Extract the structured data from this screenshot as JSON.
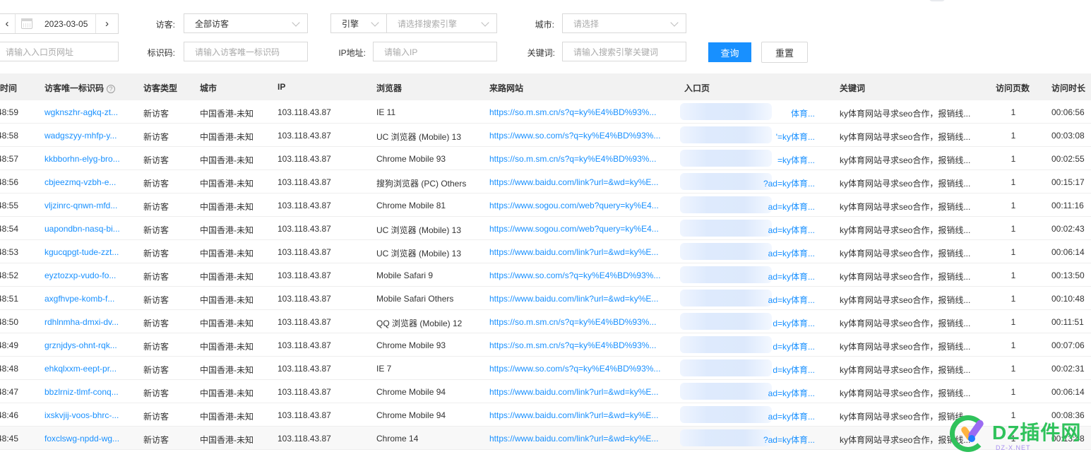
{
  "filters": {
    "date": {
      "value": "2023-03-05",
      "prev_icon": "chevron-left-icon",
      "next_icon": "chevron-right-icon",
      "calendar_icon": "calendar-icon"
    },
    "visitor": {
      "label": "访客:",
      "value": "全部访客"
    },
    "engine": {
      "type_value": "引擎",
      "placeholder": "请选择搜索引擎"
    },
    "city": {
      "label": "城市:",
      "placeholder": "请选择"
    },
    "entry_url": {
      "placeholder": "请输入入口页网址"
    },
    "visitor_id": {
      "label": "标识码:",
      "placeholder": "请输入访客唯一标识码"
    },
    "ip": {
      "label": "IP地址:",
      "placeholder": "请输入IP"
    },
    "keyword": {
      "label": "关键词:",
      "placeholder": "请输入搜索引擎关键词"
    },
    "query_label": "查询",
    "reset_label": "重置"
  },
  "table": {
    "columns": {
      "time": "访问时间",
      "id": "访客唯一标识码",
      "id_help": "?",
      "type": "访客类型",
      "city": "城市",
      "ip": "IP",
      "browser": "浏览器",
      "referrer": "来路网站",
      "entry": "入口页",
      "keyword": "关键词",
      "pages": "访问页数",
      "duration": "访问时长"
    },
    "rows": [
      {
        "time": "48:59",
        "id": "wgknszhr-agkq-zt...",
        "type": "新访客",
        "city": "中国香港-未知",
        "ip": "103.118.43.87",
        "browser": "IE 11",
        "referrer": "https://so.m.sm.cn/s?q=ky%E4%BD%93%...",
        "entry": "体育...",
        "keyword": "ky体育网站寻求seo合作，报销线...",
        "pages": "1",
        "duration": "00:06:56"
      },
      {
        "time": "48:58",
        "id": "wadgszyy-mhfp-y...",
        "type": "新访客",
        "city": "中国香港-未知",
        "ip": "103.118.43.87",
        "browser": "UC 浏览器 (Mobile) 13",
        "referrer": "https://www.so.com/s?q=ky%E4%BD%93%...",
        "entry": "'=ky体育...",
        "keyword": "ky体育网站寻求seo合作，报销线...",
        "pages": "1",
        "duration": "00:03:08"
      },
      {
        "time": "48:57",
        "id": "kkbborhn-elyg-bro...",
        "type": "新访客",
        "city": "中国香港-未知",
        "ip": "103.118.43.87",
        "browser": "Chrome Mobile 93",
        "referrer": "https://so.m.sm.cn/s?q=ky%E4%BD%93%...",
        "entry": "=ky体育...",
        "keyword": "ky体育网站寻求seo合作，报销线...",
        "pages": "1",
        "duration": "00:02:55"
      },
      {
        "time": "48:56",
        "id": "cbjeezmq-vzbh-e...",
        "type": "新访客",
        "city": "中国香港-未知",
        "ip": "103.118.43.87",
        "browser": "搜狗浏览器 (PC) Others",
        "referrer": "https://www.baidu.com/link?url=&wd=ky%E...",
        "entry": "?ad=ky体育...",
        "keyword": "ky体育网站寻求seo合作，报销线...",
        "pages": "1",
        "duration": "00:15:17"
      },
      {
        "time": "48:55",
        "id": "vljzinrc-qnwn-mfd...",
        "type": "新访客",
        "city": "中国香港-未知",
        "ip": "103.118.43.87",
        "browser": "Chrome Mobile 81",
        "referrer": "https://www.sogou.com/web?query=ky%E4...",
        "entry": "ad=ky体育...",
        "keyword": "ky体育网站寻求seo合作，报销线...",
        "pages": "1",
        "duration": "00:11:16"
      },
      {
        "time": "48:54",
        "id": "uapondbn-nasq-bi...",
        "type": "新访客",
        "city": "中国香港-未知",
        "ip": "103.118.43.87",
        "browser": "UC 浏览器 (Mobile) 13",
        "referrer": "https://www.sogou.com/web?query=ky%E4...",
        "entry": "ad=ky体育...",
        "keyword": "ky体育网站寻求seo合作，报销线...",
        "pages": "1",
        "duration": "00:02:43"
      },
      {
        "time": "48:53",
        "id": "kgucqpgt-tude-zzt...",
        "type": "新访客",
        "city": "中国香港-未知",
        "ip": "103.118.43.87",
        "browser": "UC 浏览器 (Mobile) 13",
        "referrer": "https://www.baidu.com/link?url=&wd=ky%E...",
        "entry": "ad=ky体育...",
        "keyword": "ky体育网站寻求seo合作，报销线...",
        "pages": "1",
        "duration": "00:06:14"
      },
      {
        "time": "48:52",
        "id": "eyztozxp-vudo-fo...",
        "type": "新访客",
        "city": "中国香港-未知",
        "ip": "103.118.43.87",
        "browser": "Mobile Safari 9",
        "referrer": "https://www.so.com/s?q=ky%E4%BD%93%...",
        "entry": "ad=ky体育...",
        "keyword": "ky体育网站寻求seo合作，报销线...",
        "pages": "1",
        "duration": "00:13:50"
      },
      {
        "time": "48:51",
        "id": "axgfhvpe-komb-f...",
        "type": "新访客",
        "city": "中国香港-未知",
        "ip": "103.118.43.87",
        "browser": "Mobile Safari Others",
        "referrer": "https://www.baidu.com/link?url=&wd=ky%E...",
        "entry": "ad=ky体育...",
        "keyword": "ky体育网站寻求seo合作，报销线...",
        "pages": "1",
        "duration": "00:10:48"
      },
      {
        "time": "48:50",
        "id": "rdhlnmha-dmxi-dv...",
        "type": "新访客",
        "city": "中国香港-未知",
        "ip": "103.118.43.87",
        "browser": "QQ 浏览器 (Mobile) 12",
        "referrer": "https://so.m.sm.cn/s?q=ky%E4%BD%93%...",
        "entry": "d=ky体育...",
        "keyword": "ky体育网站寻求seo合作，报销线...",
        "pages": "1",
        "duration": "00:11:51"
      },
      {
        "time": "48:49",
        "id": "grznjdys-ohnt-rqk...",
        "type": "新访客",
        "city": "中国香港-未知",
        "ip": "103.118.43.87",
        "browser": "Chrome Mobile 93",
        "referrer": "https://so.m.sm.cn/s?q=ky%E4%BD%93%...",
        "entry": "d=ky体育...",
        "keyword": "ky体育网站寻求seo合作，报销线...",
        "pages": "1",
        "duration": "00:07:06"
      },
      {
        "time": "48:48",
        "id": "ehkqlxxm-eept-pr...",
        "type": "新访客",
        "city": "中国香港-未知",
        "ip": "103.118.43.87",
        "browser": "IE 7",
        "referrer": "https://www.so.com/s?q=ky%E4%BD%93%...",
        "entry": "d=ky体育...",
        "keyword": "ky体育网站寻求seo合作，报销线...",
        "pages": "1",
        "duration": "00:02:31"
      },
      {
        "time": "48:47",
        "id": "bbzlrniz-tlmf-conq...",
        "type": "新访客",
        "city": "中国香港-未知",
        "ip": "103.118.43.87",
        "browser": "Chrome Mobile 94",
        "referrer": "https://www.baidu.com/link?url=&wd=ky%E...",
        "entry": "ad=ky体育...",
        "keyword": "ky体育网站寻求seo合作，报销线...",
        "pages": "1",
        "duration": "00:06:14"
      },
      {
        "time": "48:46",
        "id": "ixskvjij-voos-bhrc-...",
        "type": "新访客",
        "city": "中国香港-未知",
        "ip": "103.118.43.87",
        "browser": "Chrome Mobile 94",
        "referrer": "https://www.baidu.com/link?url=&wd=ky%E...",
        "entry": "ad=ky体育...",
        "keyword": "ky体育网站寻求seo合作，报销线...",
        "pages": "1",
        "duration": "00:08:36"
      },
      {
        "time": "48:45",
        "id": "foxclswg-npdd-wg...",
        "type": "新访客",
        "city": "中国香港-未知",
        "ip": "103.118.43.87",
        "browser": "Chrome 14",
        "referrer": "https://www.baidu.com/link?url=&wd=ky%E...",
        "entry": "?ad=ky体育...",
        "keyword": "ky体育网站寻求seo合作，报销线...",
        "pages": "1",
        "duration": "00:13:48"
      }
    ]
  },
  "watermark": {
    "text": "DZ插件网",
    "sub": "DZ-X.NET"
  },
  "colors": {
    "primary": "#1890ff",
    "link": "#1890ff",
    "header_bg": "#f2f2f2"
  }
}
